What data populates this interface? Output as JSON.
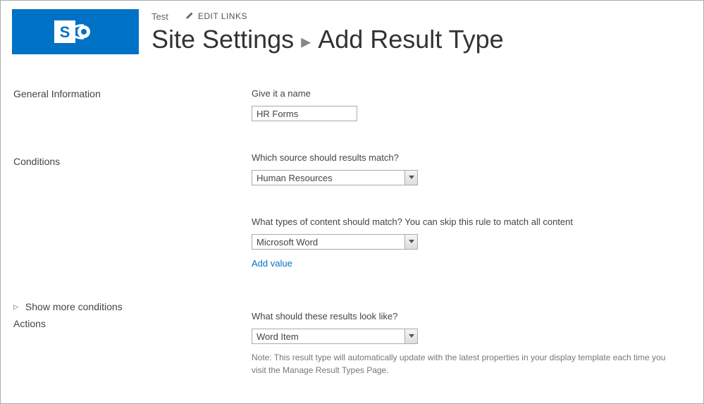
{
  "header": {
    "site_name": "Test",
    "edit_links_label": "EDIT LINKS",
    "breadcrumb_root": "Site Settings",
    "breadcrumb_sep": "▸",
    "breadcrumb_current": "Add Result Type"
  },
  "sections": {
    "general": "General Information",
    "conditions": "Conditions",
    "show_more": "Show more conditions",
    "actions": "Actions"
  },
  "fields": {
    "name_label": "Give it a name",
    "name_value": "HR Forms",
    "source_label": "Which source should results match?",
    "source_value": "Human Resources",
    "content_label": "What types of content should match? You can skip this rule to match all content",
    "content_value": "Microsoft Word",
    "add_value_link": "Add value",
    "actions_label": "What should these results look like?",
    "actions_value": "Word Item",
    "actions_note": "Note: This result type will automatically update with the latest properties in your display template each time you visit the Manage Result Types Page."
  }
}
